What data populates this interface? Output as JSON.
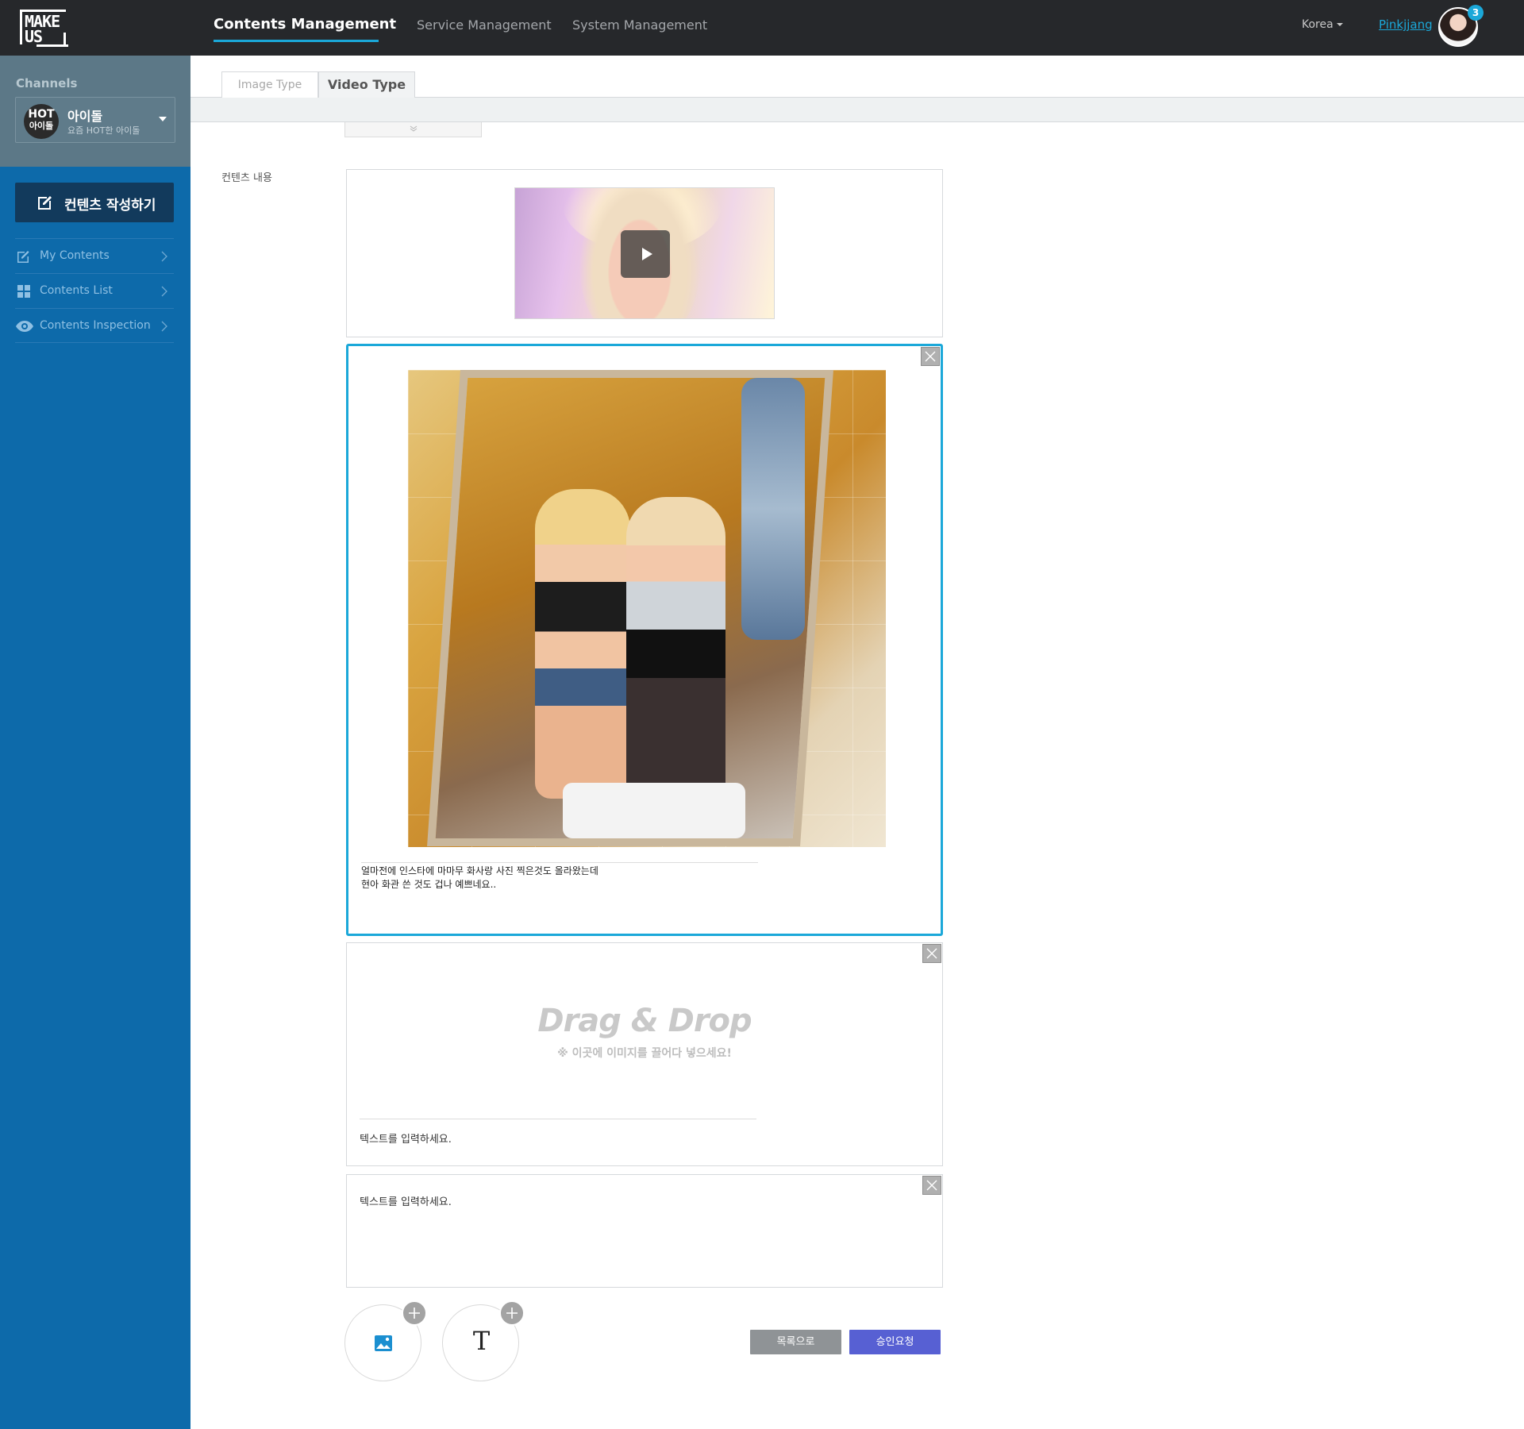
{
  "header": {
    "logo_line1": "MAKE",
    "logo_line2": "US",
    "nav": [
      {
        "label": "Contents Management",
        "active": true
      },
      {
        "label": "Service Management",
        "active": false
      },
      {
        "label": "System Management",
        "active": false
      }
    ],
    "region": "Korea",
    "username": "Pinkjjang",
    "notification_count": "3",
    "accent_color": "#1ba8d9",
    "bar_color": "#26282b"
  },
  "sidebar": {
    "channels_title": "Channels",
    "channel": {
      "badge_line1": "HOT",
      "badge_line2": "아이돌",
      "name": "아이돌",
      "subtitle": "요즘 HOT한 아이돌"
    },
    "write_button": "컨텐츠 작성하기",
    "menu": [
      {
        "label": "My Contents",
        "icon": "edit-icon"
      },
      {
        "label": "Contents List",
        "icon": "grid-icon"
      },
      {
        "label": "Contents Inspection",
        "icon": "eye-icon"
      }
    ],
    "background_color": "#0d6aaa"
  },
  "main": {
    "tabs": [
      {
        "label": "Image Type",
        "active": false
      },
      {
        "label": "Video Type",
        "active": true
      }
    ],
    "content_label": "컨텐츠 내용",
    "photo_card": {
      "caption": "얼마전에 인스타에 마마무 화사랑 사진 찍은것도 올라왔는데\n현아 화관 쓴 것도 겁나 예쁘네요.."
    },
    "drop_card": {
      "title": "Drag & Drop",
      "subtitle": "※ 이곳에 이미지를 끌어다 넣으세요!",
      "text_placeholder": "텍스트를 입력하세요."
    },
    "text_card": {
      "text_placeholder": "텍스트를 입력하세요."
    },
    "add_text_glyph": "T",
    "buttons": {
      "list": "목록으로",
      "approve": "승인요청"
    }
  }
}
